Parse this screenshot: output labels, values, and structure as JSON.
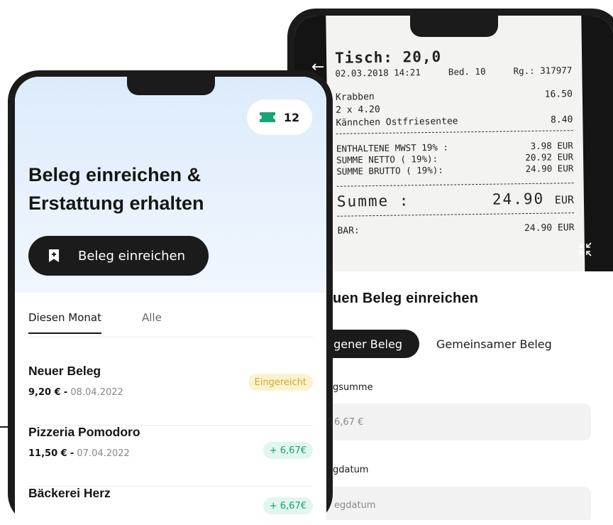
{
  "receipt": {
    "table": "Tisch: 20,0",
    "datetime": "02.03.2018 14:21",
    "bed": "Bed. 10",
    "rg": "Rg.: 317977",
    "item1_name": "Krabben",
    "item1_price": "16.50",
    "item2_qty": "2 x 4.20",
    "item2_name": "Kännchen Ostfriesentee",
    "item2_price": "8.40",
    "mwst_label": "ENTHALTENE MWST 19% :",
    "mwst_value": "3.98 EUR",
    "netto_label": "SUMME NETTO ( 19%):",
    "netto_value": "20.92 EUR",
    "brutto_label": "SUMME BRUTTO ( 19%):",
    "brutto_value": "24.90 EUR",
    "summe_label": "Summe :",
    "summe_value": "24.90",
    "summe_currency": "EUR",
    "bar_label": "BAR:",
    "bar_value": "24.90 EUR"
  },
  "form": {
    "title": "uen Beleg einreichen",
    "segment_active": "igener Beleg",
    "segment_inactive": "Gemeinsamer Beleg",
    "amount_label": "gsumme",
    "amount_value": "6,67 €",
    "date_label": "gdatum",
    "date_placeholder": "egdatum"
  },
  "front": {
    "ticket_count": "12",
    "headline_line1": "Beleg einreichen &",
    "headline_line2": "Erstattung erhalten",
    "submit_label": "Beleg einreichen",
    "tabs": [
      "Diesen Monat",
      "Alle"
    ],
    "items": [
      {
        "name": "Neuer Beleg",
        "amount": "9,20 €",
        "date": "08.04.2022",
        "badge": "Eingereicht"
      },
      {
        "name": "Pizzeria Pomodoro",
        "amount": "11,50 €",
        "date": "07.04.2022",
        "badge": "+ 6,67€"
      },
      {
        "name": "Bäckerei Herz",
        "amount": "",
        "date": "",
        "badge": "+ 6,67€"
      }
    ]
  },
  "colors": {
    "dark": "#1b1b1b",
    "accent_green": "#1c9c74",
    "ticket_icon": "#19a377",
    "badge_yellow_text": "#cfa92d",
    "hero_bg": "#dcebfb"
  }
}
